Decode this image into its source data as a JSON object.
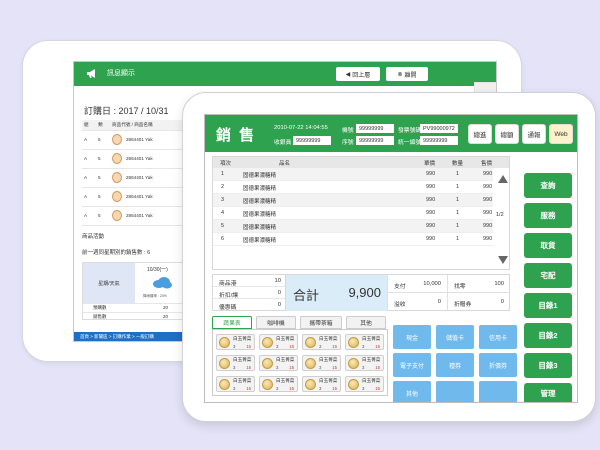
{
  "back": {
    "title": "訊息顯示",
    "btn_prev": "回上層",
    "btn_leave": "離開",
    "order_date": "訂購日 : 2017 / 10/31",
    "table_head": [
      "組",
      "類",
      "商品代號 / 商品名稱"
    ],
    "table_rows": [
      {
        "a": "A",
        "b": "5",
        "c": "2864401 Yak"
      },
      {
        "a": "A",
        "b": "5",
        "c": "2864401 Yak"
      },
      {
        "a": "A",
        "b": "5",
        "c": "2864401 Yak"
      },
      {
        "a": "A",
        "b": "5",
        "c": "2864401 Yak"
      },
      {
        "a": "A",
        "b": "5",
        "c": "2864401 Yak"
      }
    ],
    "promo_label": "商品活動",
    "promo_text": "前一週同星期別的銷售數 : 6",
    "weather_label": "星期/天氣",
    "weather_date": "10/30(一)",
    "weather_rain": "降雨機率 : 20%",
    "row1_label": "預購數",
    "row1_vals": [
      "20",
      "20"
    ],
    "row2_label": "銷售數",
    "row2_vals": [
      "20",
      "20"
    ],
    "breadcrumb": "首頁 > 新聞區 > 訂購作業 > 一般訂購"
  },
  "front": {
    "title": "銷 售",
    "datetime": "2010-07-22  14:04:55",
    "cashier_label": "收銀員",
    "cashier_val": "99999999",
    "machine_label": "機號",
    "machine_val": "99999999",
    "seq_label": "序號",
    "seq_val": "99999999",
    "invoice_label": "發票號碼",
    "invoice_val": "PV99000972",
    "uniform_label": "統一編號",
    "uniform_val": "99999999",
    "top_buttons": [
      "總進",
      "總額",
      "通報",
      "Web"
    ],
    "items_header": {
      "idx": "項次",
      "name": "品名",
      "price": "單價",
      "qty": "數量",
      "amount": "售價"
    },
    "items": [
      {
        "idx": "1",
        "name": "固德果濃糖精",
        "price": "990",
        "qty": "1",
        "amount": "990"
      },
      {
        "idx": "2",
        "name": "固德果濃糖精",
        "price": "990",
        "qty": "1",
        "amount": "990"
      },
      {
        "idx": "3",
        "name": "固德果濃糖精",
        "price": "990",
        "qty": "1",
        "amount": "990"
      },
      {
        "idx": "4",
        "name": "固德果濃糖精",
        "price": "990",
        "qty": "1",
        "amount": "990"
      },
      {
        "idx": "5",
        "name": "固德果濃糖精",
        "price": "990",
        "qty": "1",
        "amount": "990"
      },
      {
        "idx": "6",
        "name": "固德果濃糖精",
        "price": "990",
        "qty": "1",
        "amount": "990"
      }
    ],
    "page_indicator": "1/2",
    "summary": {
      "qty_label": "商品港",
      "qty_val": "10",
      "discount_label": "折扣/讓",
      "discount_val": "0",
      "promo_label": "優惠碼",
      "promo_val": "0",
      "total_label": "合計",
      "total_val": "9,900",
      "paid_label": "支付",
      "paid_val": "10,000",
      "change_label": "找零",
      "change_val": "100",
      "collect_label": "溢收",
      "collect_val": "0",
      "coupon_label": "折贈券",
      "coupon_val": "0"
    },
    "category_tabs": [
      "蔬果表",
      "咖啡機",
      "攜帶茶箱",
      "其他"
    ],
    "product": {
      "name": "白玉菁菜",
      "qty": "3",
      "price": "15"
    },
    "payments": [
      "現金",
      "儲值卡",
      "信用卡",
      "電子支付",
      "禮券",
      "折價券",
      "其他",
      "",
      ""
    ],
    "right_menu": [
      "查詢",
      "服務",
      "取貨",
      "宅配",
      "目錄1",
      "目錄2",
      "目錄3",
      "管理"
    ],
    "colors": {
      "primary": "#2ea24e",
      "pay": "#6fb9ec",
      "total_bg": "#d9ecf8",
      "background": "#e4e3f7"
    }
  }
}
